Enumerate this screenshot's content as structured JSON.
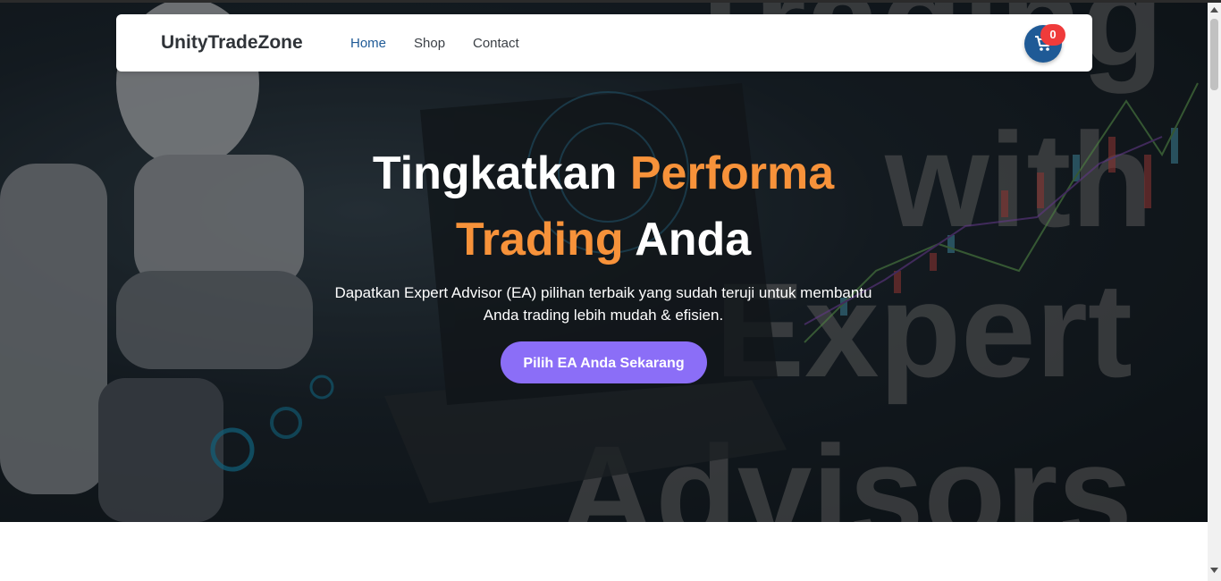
{
  "nav": {
    "brand": "UnityTradeZone",
    "links": [
      "Home",
      "Shop",
      "Contact"
    ],
    "active_link": "Home",
    "cart_count": "0",
    "cart_icon": "shopping-cart-icon"
  },
  "hero": {
    "headline_part1": "Tingkatkan ",
    "headline_accent1": "Performa",
    "headline_accent2": "Trading",
    "headline_part2": " Anda",
    "subtext": "Dapatkan Expert Advisor (EA) pilihan terbaik yang sudah teruji untuk membantu Anda trading lebih mudah & efisien.",
    "cta_label": "Pilih EA Anda Sekarang",
    "background_image": "robot-with-laptop-trading-with-expert-advisors-image"
  },
  "colors": {
    "accent_orange": "#f7923a",
    "nav_active": "#1f5a96",
    "cta_purple": "#8b6ef7",
    "badge_red": "#ef3b3b"
  }
}
